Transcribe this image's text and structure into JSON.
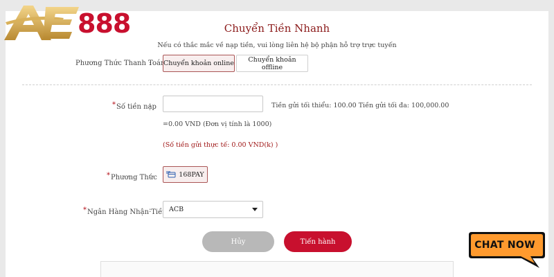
{
  "brand": {
    "logo_number": "888",
    "colors": {
      "gold": "#d9b15a",
      "red": "#c8102e",
      "title_red": "#8b1a1a"
    }
  },
  "page": {
    "title": "Chuyển Tiền Nhanh",
    "subtitle": "Nếu có thắc mắc về nạp tiền, vui lòng liên hệ bộ phận hỗ trợ trực tuyến"
  },
  "payment_method": {
    "label": "Phương Thức Thanh Toán",
    "colon": ":",
    "options": [
      {
        "label": "Chuyển khoản online",
        "selected": true
      },
      {
        "label": "Chuyển khoản offline",
        "selected": false
      }
    ]
  },
  "amount": {
    "required_mark": "*",
    "label": "Số tiền nạp",
    "colon": ":",
    "value": "",
    "placeholder": "",
    "limits": "Tiền gửi tối thiểu: 100.00 Tiền gửi tối đa: 100,000.00",
    "converted": "=0.00 VND (Đơn vị tính là 1000)",
    "actual": "(Số tiền gửi thực tế: 0.00 VND(k) )"
  },
  "method": {
    "required_mark": "*",
    "label": "Phương Thức",
    "colon": ":",
    "selected_chip": "168PAY",
    "chip_icon": "card-transfer-icon"
  },
  "bank": {
    "required_mark": "*",
    "label": "Ngân Hàng Nhận Tiền",
    "colon": ":",
    "selected": "ACB"
  },
  "actions": {
    "cancel": "Hủy",
    "proceed": "Tiến hành"
  },
  "chat": {
    "label": "CHAT NOW",
    "colors": {
      "bubble": "#ff9a2e"
    }
  }
}
